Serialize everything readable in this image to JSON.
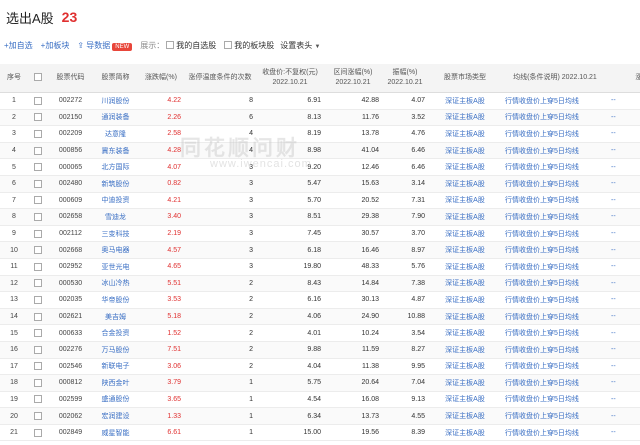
{
  "header": {
    "title": "选出A股",
    "count": "23"
  },
  "toolbar": {
    "add_watch": "+加自选",
    "add_block": "+加板块",
    "export": "⇪ 导数据",
    "new_badge": "NEW",
    "display_label": "展示：",
    "my_watch": "我的自选股",
    "my_block": "我的板块股",
    "settings": "设置表头"
  },
  "columns": [
    "序号",
    "",
    "股票代码",
    "股票简称",
    "涨跌幅(%)",
    "涨停温度条件的次数",
    "收盘价:不复权(元) 2022.10.21",
    "区间涨幅(%) 2022.10.21",
    "振幅(%) 2022.10.21",
    "股票市场类型",
    "均线(条件说明) 2022.10.21",
    "涨停 2022.1"
  ],
  "rows": [
    {
      "no": "1",
      "code": "002272",
      "name": "川润股份",
      "chg": "4.22",
      "cnt": "8",
      "close": "6.91",
      "range": "42.88",
      "amp": "4.07",
      "market": "深证主板A股",
      "cond": "行情收盘价上穿5日均线",
      "last": "--"
    },
    {
      "no": "2",
      "code": "002150",
      "name": "通润装备",
      "chg": "2.26",
      "cnt": "6",
      "close": "8.13",
      "range": "11.76",
      "amp": "3.52",
      "market": "深证主板A股",
      "cond": "行情收盘价上穿5日均线",
      "last": "--"
    },
    {
      "no": "3",
      "code": "002209",
      "name": "达意隆",
      "chg": "2.58",
      "cnt": "4",
      "close": "8.19",
      "range": "13.78",
      "amp": "4.76",
      "market": "深证主板A股",
      "cond": "行情收盘价上穿5日均线",
      "last": "--"
    },
    {
      "no": "4",
      "code": "000856",
      "name": "冀东装备",
      "chg": "4.28",
      "cnt": "4",
      "close": "8.98",
      "range": "41.04",
      "amp": "6.46",
      "market": "深证主板A股",
      "cond": "行情收盘价上穿5日均线",
      "last": "--"
    },
    {
      "no": "5",
      "code": "000065",
      "name": "北方国际",
      "chg": "4.07",
      "cnt": "3",
      "close": "9.20",
      "range": "12.46",
      "amp": "6.46",
      "market": "深证主板A股",
      "cond": "行情收盘价上穿5日均线",
      "last": "--"
    },
    {
      "no": "6",
      "code": "002480",
      "name": "新筑股份",
      "chg": "0.82",
      "cnt": "3",
      "close": "5.47",
      "range": "15.63",
      "amp": "3.14",
      "market": "深证主板A股",
      "cond": "行情收盘价上穿5日均线",
      "last": "--"
    },
    {
      "no": "7",
      "code": "000609",
      "name": "中迪投资",
      "chg": "4.21",
      "cnt": "3",
      "close": "5.70",
      "range": "20.52",
      "amp": "7.31",
      "market": "深证主板A股",
      "cond": "行情收盘价上穿5日均线",
      "last": "--"
    },
    {
      "no": "8",
      "code": "002658",
      "name": "雪迪龙",
      "chg": "3.40",
      "cnt": "3",
      "close": "8.51",
      "range": "29.38",
      "amp": "7.90",
      "market": "深证主板A股",
      "cond": "行情收盘价上穿5日均线",
      "last": "--"
    },
    {
      "no": "9",
      "code": "002112",
      "name": "三变科技",
      "chg": "2.19",
      "cnt": "3",
      "close": "7.45",
      "range": "30.57",
      "amp": "3.70",
      "market": "深证主板A股",
      "cond": "行情收盘价上穿5日均线",
      "last": "--"
    },
    {
      "no": "10",
      "code": "002668",
      "name": "奥马电器",
      "chg": "4.57",
      "cnt": "3",
      "close": "6.18",
      "range": "16.46",
      "amp": "8.97",
      "market": "深证主板A股",
      "cond": "行情收盘价上穿5日均线",
      "last": "--"
    },
    {
      "no": "11",
      "code": "002952",
      "name": "亚世光电",
      "chg": "4.65",
      "cnt": "3",
      "close": "19.80",
      "range": "48.33",
      "amp": "5.76",
      "market": "深证主板A股",
      "cond": "行情收盘价上穿5日均线",
      "last": "--"
    },
    {
      "no": "12",
      "code": "000530",
      "name": "冰山冷热",
      "chg": "5.51",
      "cnt": "2",
      "close": "8.43",
      "range": "14.84",
      "amp": "7.38",
      "market": "深证主板A股",
      "cond": "行情收盘价上穿5日均线",
      "last": "--"
    },
    {
      "no": "13",
      "code": "002035",
      "name": "华帝股份",
      "chg": "3.53",
      "cnt": "2",
      "close": "6.16",
      "range": "30.13",
      "amp": "4.87",
      "market": "深证主板A股",
      "cond": "行情收盘价上穿5日均线",
      "last": "--"
    },
    {
      "no": "14",
      "code": "002621",
      "name": "美吉姆",
      "chg": "5.18",
      "cnt": "2",
      "close": "4.06",
      "range": "24.90",
      "amp": "10.88",
      "market": "深证主板A股",
      "cond": "行情收盘价上穿5日均线",
      "last": "--"
    },
    {
      "no": "15",
      "code": "000633",
      "name": "合金投资",
      "chg": "1.52",
      "cnt": "2",
      "close": "4.01",
      "range": "10.24",
      "amp": "3.54",
      "market": "深证主板A股",
      "cond": "行情收盘价上穿5日均线",
      "last": "--"
    },
    {
      "no": "16",
      "code": "002276",
      "name": "万马股份",
      "chg": "7.51",
      "cnt": "2",
      "close": "9.88",
      "range": "11.59",
      "amp": "8.27",
      "market": "深证主板A股",
      "cond": "行情收盘价上穿5日均线",
      "last": "--"
    },
    {
      "no": "17",
      "code": "002546",
      "name": "新联电子",
      "chg": "3.06",
      "cnt": "2",
      "close": "4.04",
      "range": "11.38",
      "amp": "9.95",
      "market": "深证主板A股",
      "cond": "行情收盘价上穿5日均线",
      "last": "--"
    },
    {
      "no": "18",
      "code": "000812",
      "name": "陕西金叶",
      "chg": "3.79",
      "cnt": "1",
      "close": "5.75",
      "range": "20.64",
      "amp": "7.04",
      "market": "深证主板A股",
      "cond": "行情收盘价上穿5日均线",
      "last": "--"
    },
    {
      "no": "19",
      "code": "002599",
      "name": "盛通股份",
      "chg": "3.65",
      "cnt": "1",
      "close": "4.54",
      "range": "16.08",
      "amp": "9.13",
      "market": "深证主板A股",
      "cond": "行情收盘价上穿5日均线",
      "last": "--"
    },
    {
      "no": "20",
      "code": "002062",
      "name": "宏润建设",
      "chg": "1.33",
      "cnt": "1",
      "close": "6.34",
      "range": "13.73",
      "amp": "4.55",
      "market": "深证主板A股",
      "cond": "行情收盘价上穿5日均线",
      "last": "--"
    },
    {
      "no": "21",
      "code": "002849",
      "name": "威星智能",
      "chg": "6.61",
      "cnt": "1",
      "close": "15.00",
      "range": "19.56",
      "amp": "8.39",
      "market": "深证主板A股",
      "cond": "行情收盘价上穿5日均线",
      "last": "--"
    }
  ],
  "watermark": {
    "main": "同花顺问财",
    "sub": "www.iwencai.com"
  },
  "colors": {
    "up": "#e03030",
    "link": "#3a6fc4",
    "header_bg": "#f4f4f4"
  }
}
